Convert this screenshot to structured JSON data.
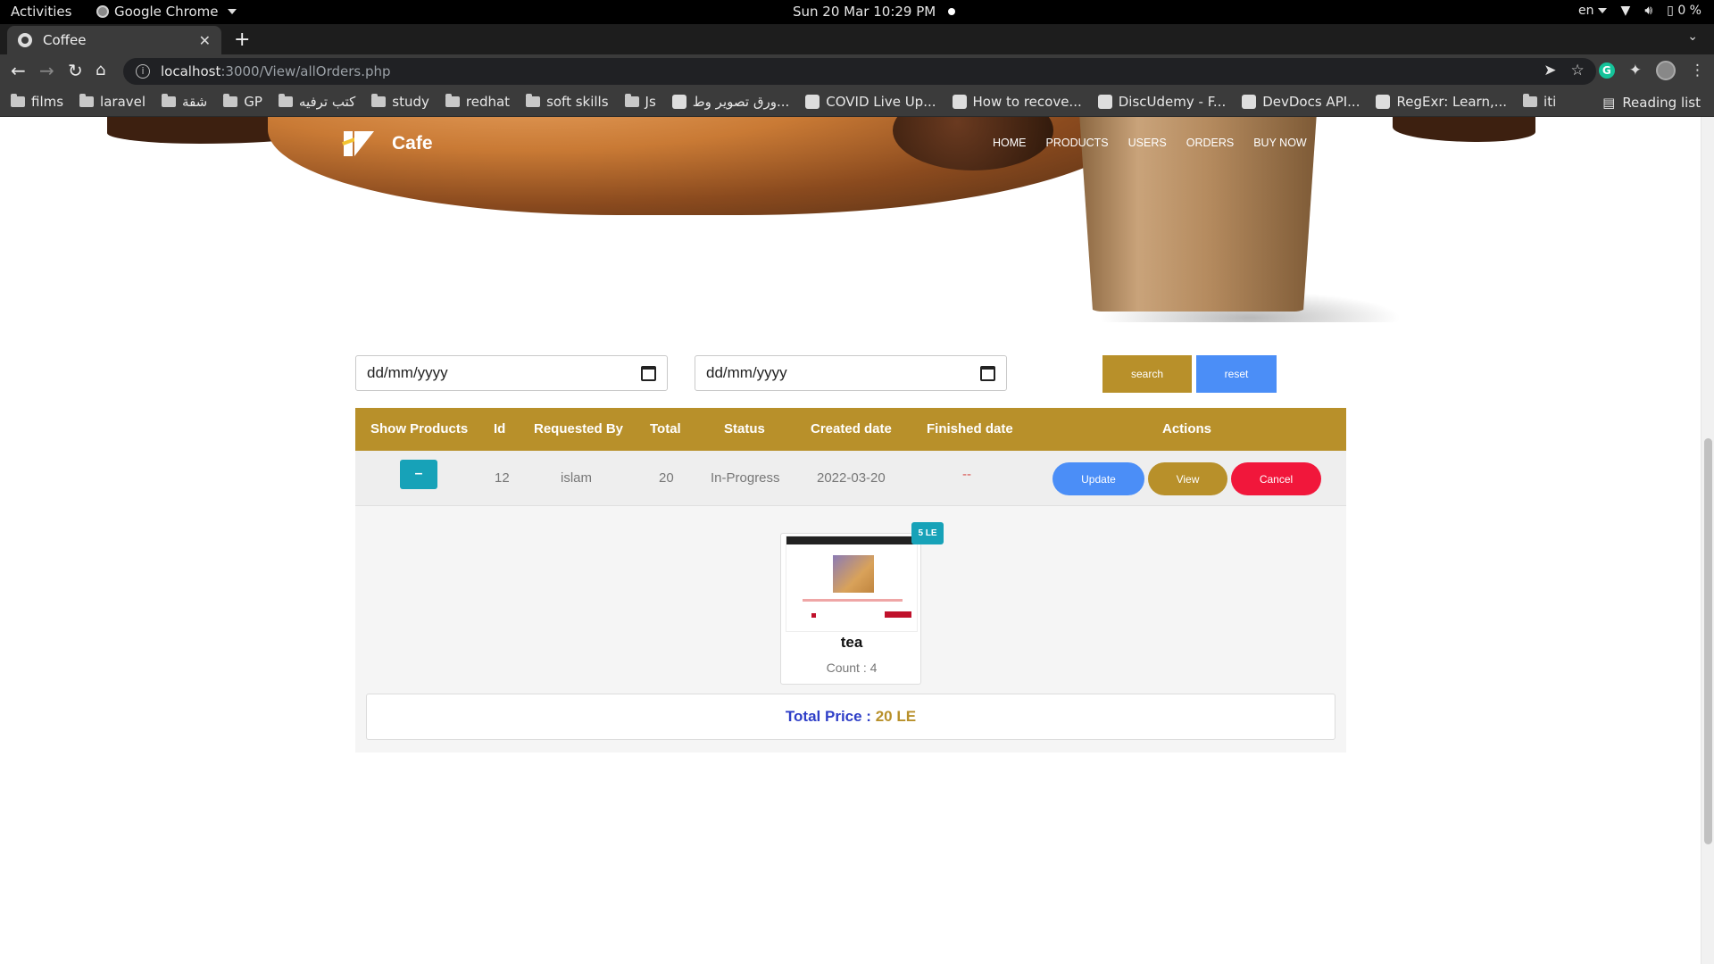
{
  "os": {
    "activities": "Activities",
    "app_name": "Google Chrome",
    "clock": "Sun 20 Mar  10:29 PM",
    "lang": "en",
    "battery": "0 %"
  },
  "browser": {
    "tab_title": "Coffee",
    "url_host": "localhost",
    "url_path": ":3000/View/allOrders.php",
    "bookmarks": [
      {
        "label": "films",
        "icon": "folder-icon"
      },
      {
        "label": "laravel",
        "icon": "folder-icon"
      },
      {
        "label": "شقة",
        "icon": "folder-icon"
      },
      {
        "label": "GP",
        "icon": "folder-icon"
      },
      {
        "label": "كتب ترفيه",
        "icon": "folder-icon"
      },
      {
        "label": "study",
        "icon": "folder-icon"
      },
      {
        "label": "redhat",
        "icon": "folder-icon"
      },
      {
        "label": "soft skills",
        "icon": "folder-icon"
      },
      {
        "label": "Js",
        "icon": "folder-icon"
      },
      {
        "label": "ورق تصوير وط...",
        "icon": "amazon-icon"
      },
      {
        "label": "COVID Live Up...",
        "icon": "site-icon"
      },
      {
        "label": "How to recove...",
        "icon": "github-icon"
      },
      {
        "label": "DiscUdemy - F...",
        "icon": "site-icon"
      },
      {
        "label": "DevDocs API...",
        "icon": "site-icon"
      },
      {
        "label": "RegExr: Learn,...",
        "icon": "site-icon"
      },
      {
        "label": "iti",
        "icon": "folder-icon"
      }
    ],
    "reading_list": "Reading list"
  },
  "site": {
    "logo_text": "Cafe",
    "nav": [
      "HOME",
      "PRODUCTS",
      "USERS",
      "ORDERS",
      "BUY NOW"
    ]
  },
  "filters": {
    "date_from_placeholder": "dd/mm/yyyy",
    "date_to_placeholder": "dd/mm/yyyy",
    "search_label": "search",
    "reset_label": "reset"
  },
  "table": {
    "headers": {
      "show_products": "Show Products",
      "id": "Id",
      "requested_by": "Requested By",
      "total": "Total",
      "status": "Status",
      "created": "Created date",
      "finished": "Finished date",
      "actions": "Actions"
    },
    "rows": [
      {
        "toggle": "–",
        "id": "12",
        "requested_by": "islam",
        "total": "20",
        "status": "In-Progress",
        "created": "2022-03-20",
        "finished": "--",
        "update_label": "Update",
        "view_label": "View",
        "cancel_label": "Cancel"
      }
    ]
  },
  "order_detail": {
    "products": [
      {
        "name": "tea",
        "price_badge": "5 LE",
        "count": "Count : 4"
      }
    ],
    "total_label": "Total Price :",
    "total_value": "20 LE"
  },
  "colors": {
    "gold": "#b8902a",
    "blue": "#4b8ef7",
    "red": "#f1173b",
    "teal": "#17a2b8"
  }
}
